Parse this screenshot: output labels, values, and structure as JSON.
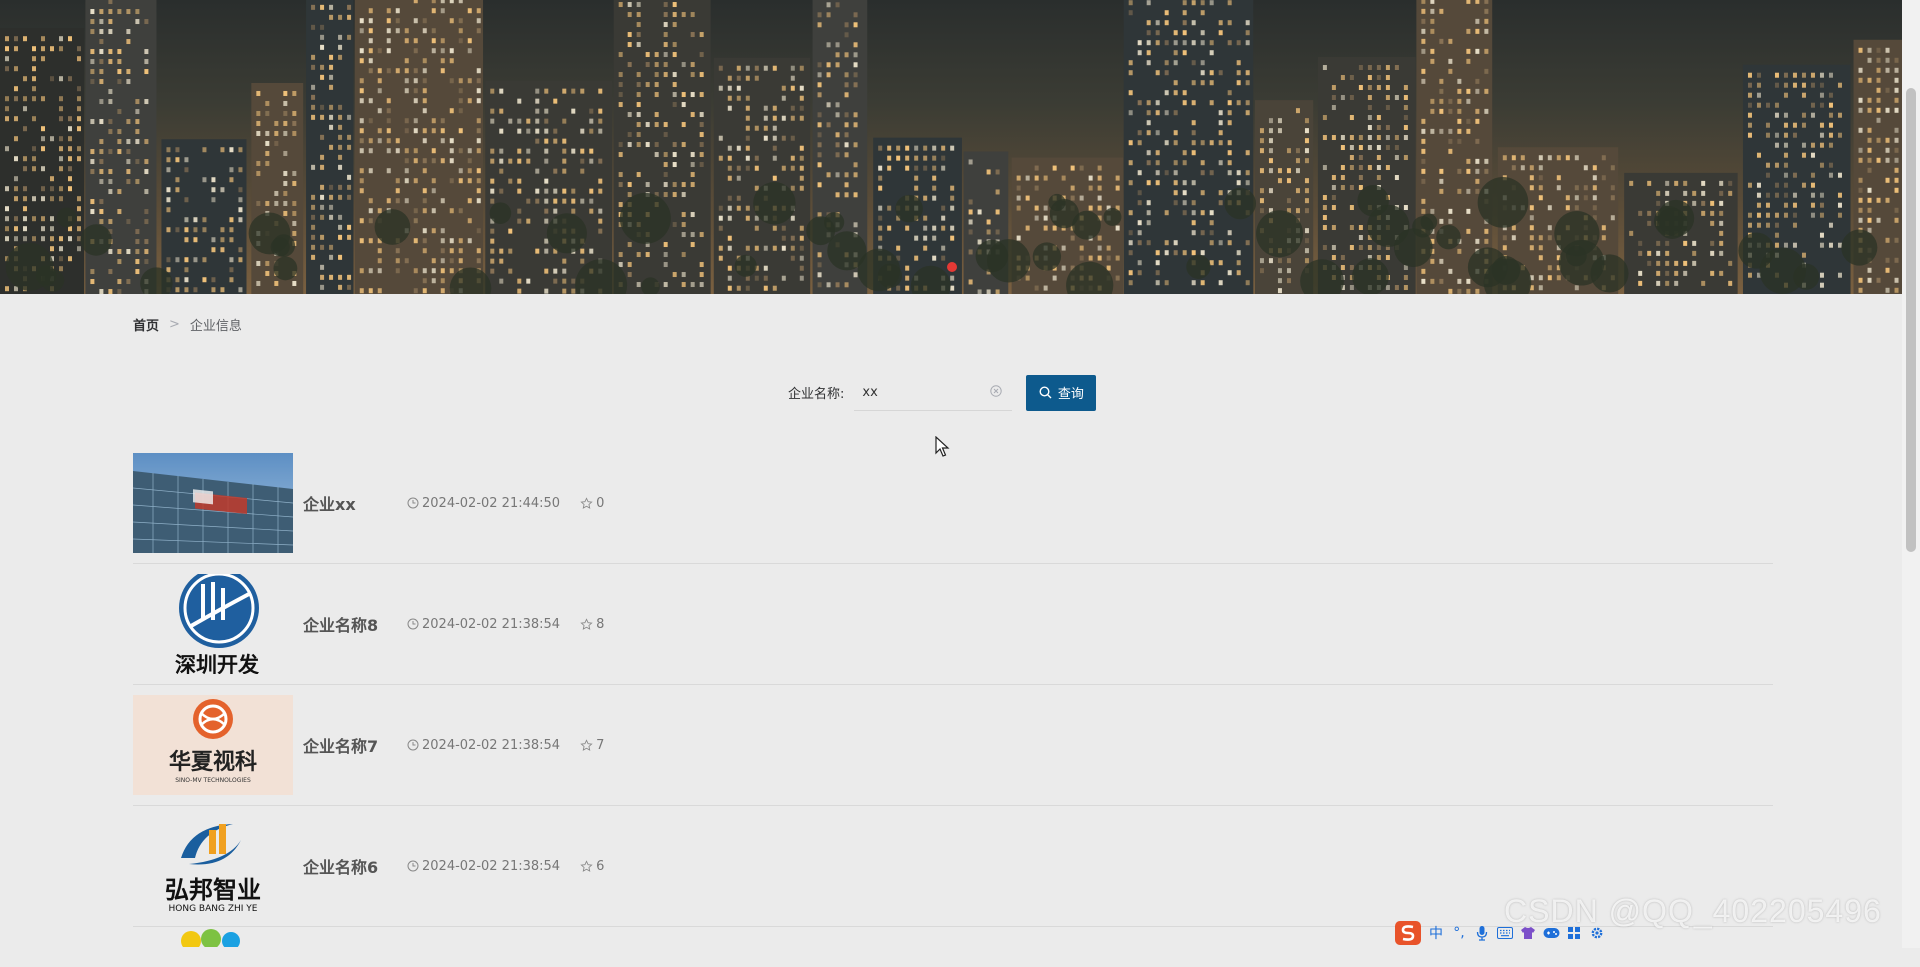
{
  "breadcrumb": {
    "home": "首页",
    "separator": ">",
    "current": "企业信息"
  },
  "search": {
    "label": "企业名称:",
    "value": "xx",
    "button_label": "查询"
  },
  "items": [
    {
      "name": "企业xx",
      "time": "2024-02-02 21:44:50",
      "stars": "0",
      "logo": "building-photo"
    },
    {
      "name": "企业名称8",
      "time": "2024-02-02 21:38:54",
      "stars": "8",
      "logo": "shenzhen-development-logo",
      "logo_text": "深圳开发"
    },
    {
      "name": "企业名称7",
      "time": "2024-02-02 21:38:54",
      "stars": "7",
      "logo": "huaxia-shike-logo",
      "logo_text": "华夏视科",
      "logo_subtext": "SINO-MV TECHNOLOGIES"
    },
    {
      "name": "企业名称6",
      "time": "2024-02-02 21:38:54",
      "stars": "6",
      "logo": "hongbang-zhiye-logo",
      "logo_text": "弘邦智业",
      "logo_subtext": "HONG BANG ZHI YE"
    }
  ],
  "ime_toolbar": {
    "mode": "中",
    "punct": "°,"
  },
  "watermark": "CSDN @QQ_402205496",
  "colors": {
    "accent": "#0d5a8d",
    "background": "#ebebeb"
  },
  "icons": [
    "clock-icon",
    "star-icon",
    "search-icon",
    "clear-icon",
    "cursor-icon",
    "microphone-icon",
    "keyboard-icon",
    "shirt-icon",
    "gamepad-icon",
    "grid-icon",
    "settings-icon"
  ]
}
